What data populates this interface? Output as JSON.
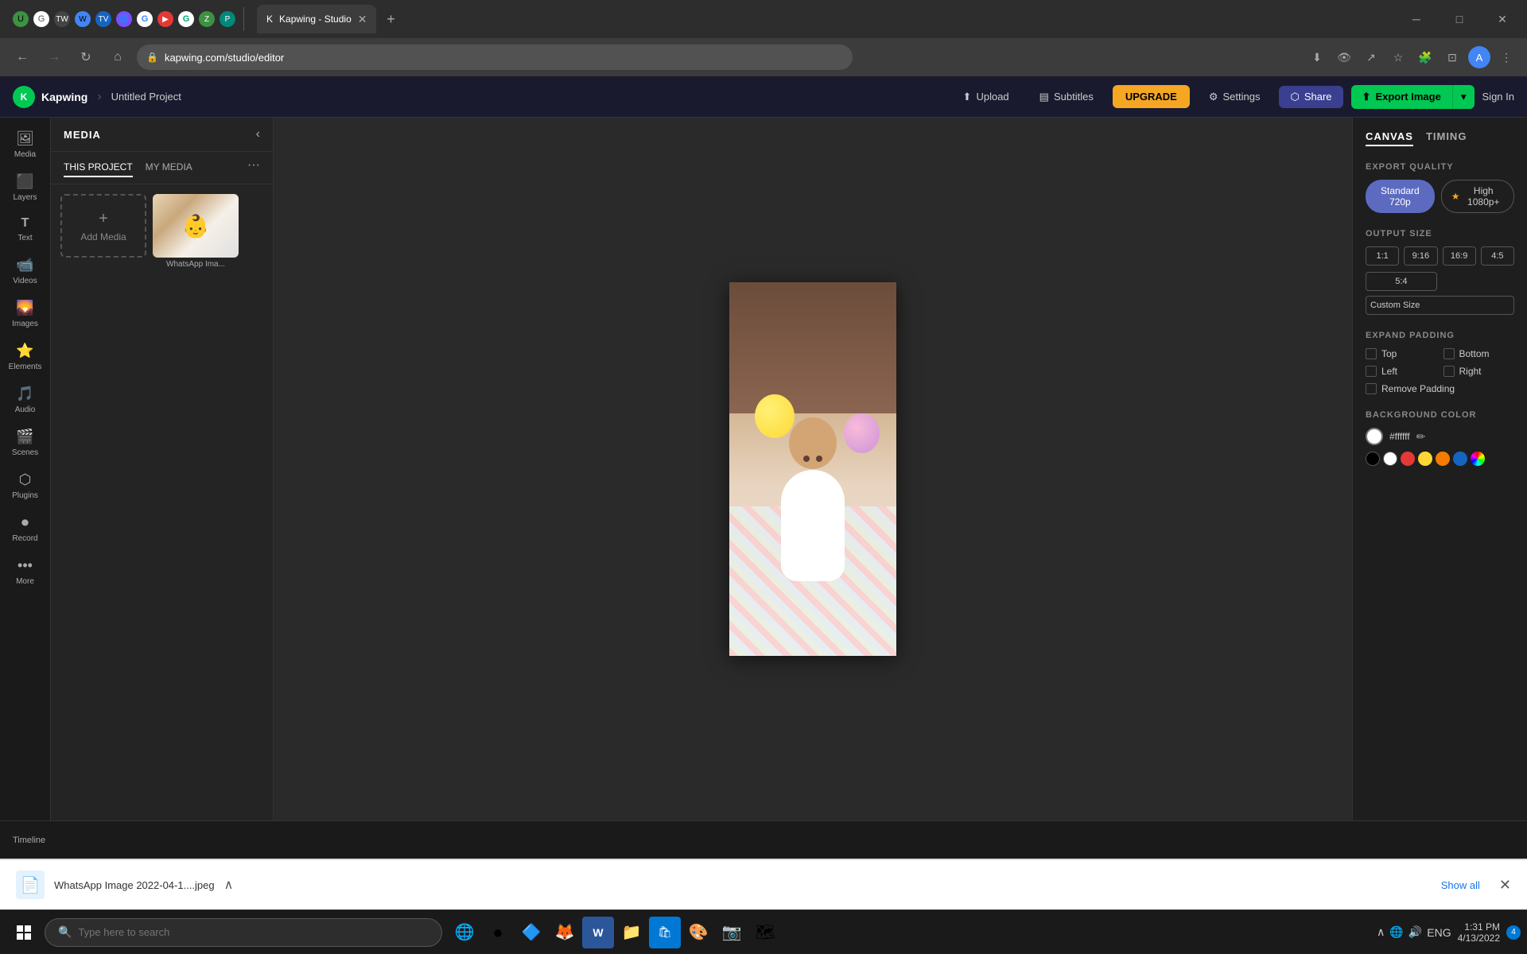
{
  "browser": {
    "tabs": [
      {
        "label": "Kapwing Studio",
        "url": "kapwing.com/studio/editor",
        "active": true
      }
    ],
    "address": "kapwing.com/studio/editor",
    "window_controls": [
      "minimize",
      "maximize",
      "close"
    ]
  },
  "app_header": {
    "logo_text": "Kapwing",
    "project_name": "Untitled Project",
    "upload_label": "Upload",
    "subtitles_label": "Subtitles",
    "upgrade_label": "UPGRADE",
    "settings_label": "Settings",
    "share_label": "Share",
    "export_label": "Export Image",
    "signin_label": "Sign In"
  },
  "sidebar": {
    "items": [
      {
        "label": "Media",
        "icon": "🖼"
      },
      {
        "label": "Layers",
        "icon": "⬛"
      },
      {
        "label": "Text",
        "icon": "T"
      },
      {
        "label": "Videos",
        "icon": "📹"
      },
      {
        "label": "Images",
        "icon": "🌄"
      },
      {
        "label": "Elements",
        "icon": "⭐"
      },
      {
        "label": "Audio",
        "icon": "🎵"
      },
      {
        "label": "Scenes",
        "icon": "🎬"
      },
      {
        "label": "Plugins",
        "icon": "🔌"
      },
      {
        "label": "Record",
        "icon": "⏺"
      },
      {
        "label": "More",
        "icon": "•••"
      }
    ]
  },
  "media_panel": {
    "title": "MEDIA",
    "tabs": [
      "THIS PROJECT",
      "MY MEDIA"
    ],
    "active_tab": "THIS PROJECT",
    "add_media_label": "Add Media",
    "files": [
      {
        "name": "WhatsApp Ima...",
        "thumb": "baby"
      }
    ]
  },
  "right_panel": {
    "tabs": [
      "CANVAS",
      "TIMING"
    ],
    "active_tab": "CANVAS",
    "export_quality_label": "EXPORT QUALITY",
    "quality_options": [
      {
        "label": "Standard 720p",
        "active": true
      },
      {
        "label": "High 1080p+",
        "active": false,
        "star": true
      }
    ],
    "output_size_label": "OUTPUT SIZE",
    "size_options": [
      "1:1",
      "9:16",
      "16:9",
      "4:5",
      "5:4"
    ],
    "custom_size_label": "Custom Size",
    "expand_padding_label": "EXPAND PADDING",
    "padding_options": [
      "Top",
      "Bottom",
      "Left",
      "Right"
    ],
    "remove_padding_label": "Remove Padding",
    "bg_color_label": "BACKGROUND COLOR",
    "bg_hex": "#ffffff",
    "color_swatches": [
      "black",
      "white",
      "red",
      "yellow",
      "orange",
      "blue",
      "rainbow"
    ]
  },
  "download_bar": {
    "filename": "WhatsApp Image 2022-04-1....jpeg",
    "show_all_label": "Show all"
  },
  "taskbar": {
    "search_placeholder": "Type here to search",
    "time": "1:31 PM",
    "date": "4/13/2022",
    "lang": "ENG",
    "notification_count": "4"
  }
}
